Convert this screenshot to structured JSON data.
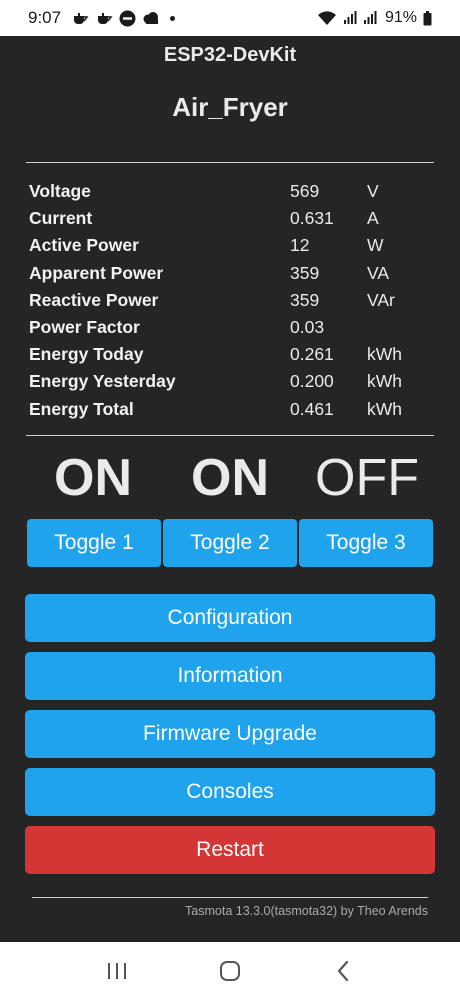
{
  "statusbar": {
    "time": "9:07",
    "battery_text": "91%"
  },
  "header": {
    "device_name": "ESP32-DevKit",
    "module_name": "Air_Fryer"
  },
  "sensors": [
    {
      "label": "Voltage",
      "value": "569",
      "unit": "V"
    },
    {
      "label": "Current",
      "value": "0.631",
      "unit": "A"
    },
    {
      "label": "Active Power",
      "value": "12",
      "unit": "W"
    },
    {
      "label": "Apparent Power",
      "value": "359",
      "unit": "VA"
    },
    {
      "label": "Reactive Power",
      "value": "359",
      "unit": "VAr"
    },
    {
      "label": "Power Factor",
      "value": "0.03",
      "unit": ""
    },
    {
      "label": "Energy Today",
      "value": "0.261",
      "unit": "kWh"
    },
    {
      "label": "Energy Yesterday",
      "value": "0.200",
      "unit": "kWh"
    },
    {
      "label": "Energy Total",
      "value": "0.461",
      "unit": "kWh"
    }
  ],
  "relays": [
    {
      "state": "ON",
      "toggle_label": "Toggle 1"
    },
    {
      "state": "ON",
      "toggle_label": "Toggle 2"
    },
    {
      "state": "OFF",
      "toggle_label": "Toggle 3"
    }
  ],
  "menu": {
    "configuration": "Configuration",
    "information": "Information",
    "firmware_upgrade": "Firmware Upgrade",
    "consoles": "Consoles",
    "restart": "Restart"
  },
  "footer": {
    "text": "Tasmota 13.3.0(tasmota32) by Theo Arends"
  },
  "colors": {
    "background": "#252525",
    "button": "#1fa3ec",
    "restart_button": "#d43535",
    "text": "#eaeaea"
  },
  "icons": {
    "status_left": [
      "teapot-icon",
      "teapot-icon",
      "do-not-disturb-icon",
      "cloud-icon",
      "dot-icon"
    ],
    "status_right": [
      "wifi-icon",
      "signal-icon",
      "signal-icon",
      "battery-icon"
    ],
    "nav": [
      "recent-apps-icon",
      "home-icon",
      "back-icon"
    ]
  }
}
